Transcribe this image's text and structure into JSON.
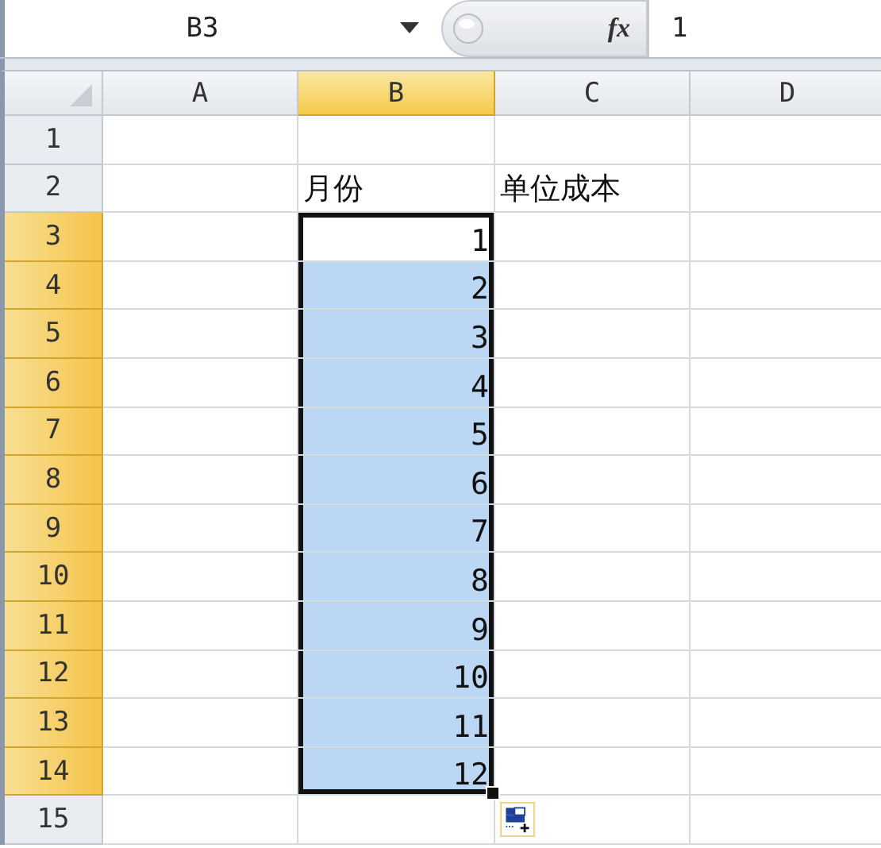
{
  "formula_bar": {
    "name_box": "B3",
    "fx_label": "fx",
    "formula": "1"
  },
  "columns": [
    {
      "label": "A",
      "selected": false
    },
    {
      "label": "B",
      "selected": true
    },
    {
      "label": "C",
      "selected": false
    },
    {
      "label": "D",
      "selected": false
    }
  ],
  "rows": [
    {
      "label": "1",
      "selected": false,
      "cells": [
        {
          "selected": false
        },
        {
          "selected": false
        },
        {
          "selected": false
        },
        {
          "selected": false
        }
      ]
    },
    {
      "label": "2",
      "selected": false,
      "cells": [
        {
          "selected": false
        },
        {
          "selected": false,
          "text": "月份",
          "kind": "text"
        },
        {
          "selected": false,
          "text": "单位成本",
          "kind": "text"
        },
        {
          "selected": false
        }
      ]
    },
    {
      "label": "3",
      "selected": true,
      "cells": [
        {
          "selected": false
        },
        {
          "selected": true,
          "active": true,
          "text": "1",
          "kind": "number"
        },
        {
          "selected": false
        },
        {
          "selected": false
        }
      ]
    },
    {
      "label": "4",
      "selected": true,
      "cells": [
        {
          "selected": false
        },
        {
          "selected": true,
          "text": "2",
          "kind": "number"
        },
        {
          "selected": false
        },
        {
          "selected": false
        }
      ]
    },
    {
      "label": "5",
      "selected": true,
      "cells": [
        {
          "selected": false
        },
        {
          "selected": true,
          "text": "3",
          "kind": "number"
        },
        {
          "selected": false
        },
        {
          "selected": false
        }
      ]
    },
    {
      "label": "6",
      "selected": true,
      "cells": [
        {
          "selected": false
        },
        {
          "selected": true,
          "text": "4",
          "kind": "number"
        },
        {
          "selected": false
        },
        {
          "selected": false
        }
      ]
    },
    {
      "label": "7",
      "selected": true,
      "cells": [
        {
          "selected": false
        },
        {
          "selected": true,
          "text": "5",
          "kind": "number"
        },
        {
          "selected": false
        },
        {
          "selected": false
        }
      ]
    },
    {
      "label": "8",
      "selected": true,
      "cells": [
        {
          "selected": false
        },
        {
          "selected": true,
          "text": "6",
          "kind": "number"
        },
        {
          "selected": false
        },
        {
          "selected": false
        }
      ]
    },
    {
      "label": "9",
      "selected": true,
      "cells": [
        {
          "selected": false
        },
        {
          "selected": true,
          "text": "7",
          "kind": "number"
        },
        {
          "selected": false
        },
        {
          "selected": false
        }
      ]
    },
    {
      "label": "10",
      "selected": true,
      "cells": [
        {
          "selected": false
        },
        {
          "selected": true,
          "text": "8",
          "kind": "number"
        },
        {
          "selected": false
        },
        {
          "selected": false
        }
      ]
    },
    {
      "label": "11",
      "selected": true,
      "cells": [
        {
          "selected": false
        },
        {
          "selected": true,
          "text": "9",
          "kind": "number"
        },
        {
          "selected": false
        },
        {
          "selected": false
        }
      ]
    },
    {
      "label": "12",
      "selected": true,
      "cells": [
        {
          "selected": false
        },
        {
          "selected": true,
          "text": "10",
          "kind": "number"
        },
        {
          "selected": false
        },
        {
          "selected": false
        }
      ]
    },
    {
      "label": "13",
      "selected": true,
      "cells": [
        {
          "selected": false
        },
        {
          "selected": true,
          "text": "11",
          "kind": "number"
        },
        {
          "selected": false
        },
        {
          "selected": false
        }
      ]
    },
    {
      "label": "14",
      "selected": true,
      "cells": [
        {
          "selected": false
        },
        {
          "selected": true,
          "text": "12",
          "kind": "number"
        },
        {
          "selected": false
        },
        {
          "selected": false
        }
      ]
    },
    {
      "label": "15",
      "selected": false,
      "cells": [
        {
          "selected": false
        },
        {
          "selected": false
        },
        {
          "selected": false
        },
        {
          "selected": false
        }
      ]
    }
  ]
}
